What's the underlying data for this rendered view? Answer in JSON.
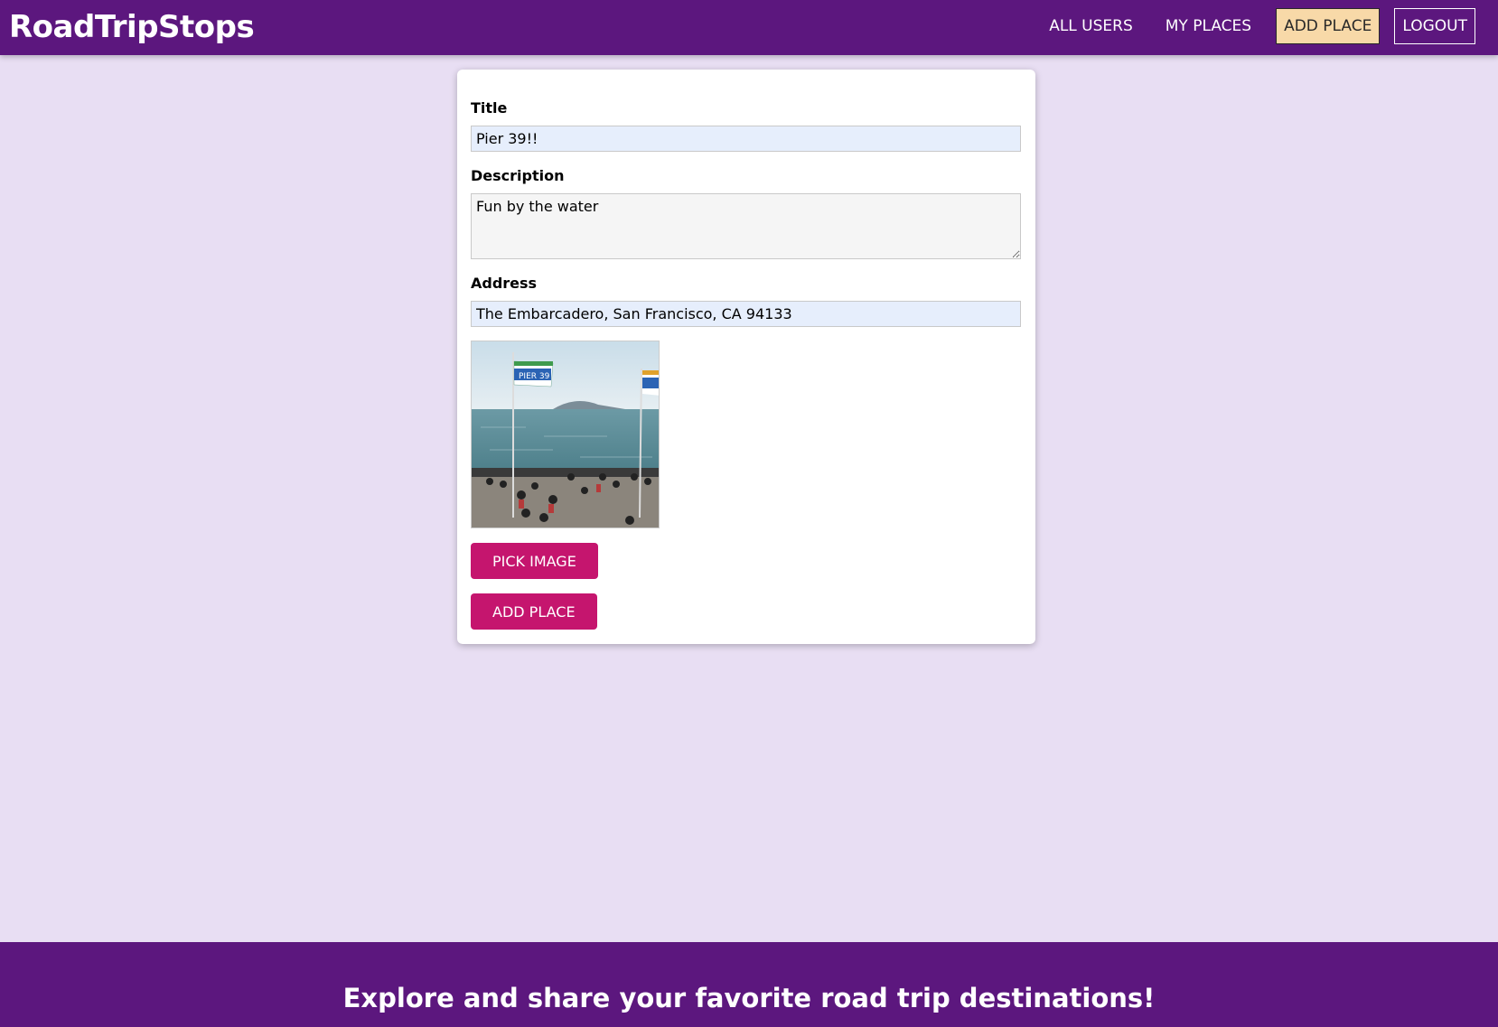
{
  "header": {
    "brand": "RoadTripStops",
    "nav": {
      "all_users": "ALL USERS",
      "my_places": "MY PLACES",
      "add_place": "ADD PLACE",
      "logout": "LOGOUT"
    }
  },
  "form": {
    "title": {
      "label": "Title",
      "value": "Pier 39!!"
    },
    "description": {
      "label": "Description",
      "value": "Fun by the water"
    },
    "address": {
      "label": "Address",
      "value": "The Embarcadero, San Francisco, CA 94133"
    },
    "image_preview": {
      "flag_text": "PIER 39"
    },
    "pick_image_label": "PICK IMAGE",
    "submit_label": "ADD PLACE"
  },
  "footer": {
    "tagline": "Explore and share your favorite road trip destinations!"
  },
  "colors": {
    "primary": "#5c177e",
    "accent": "#c5156e",
    "active_nav": "#f8d9a8",
    "background": "#e8def3"
  }
}
